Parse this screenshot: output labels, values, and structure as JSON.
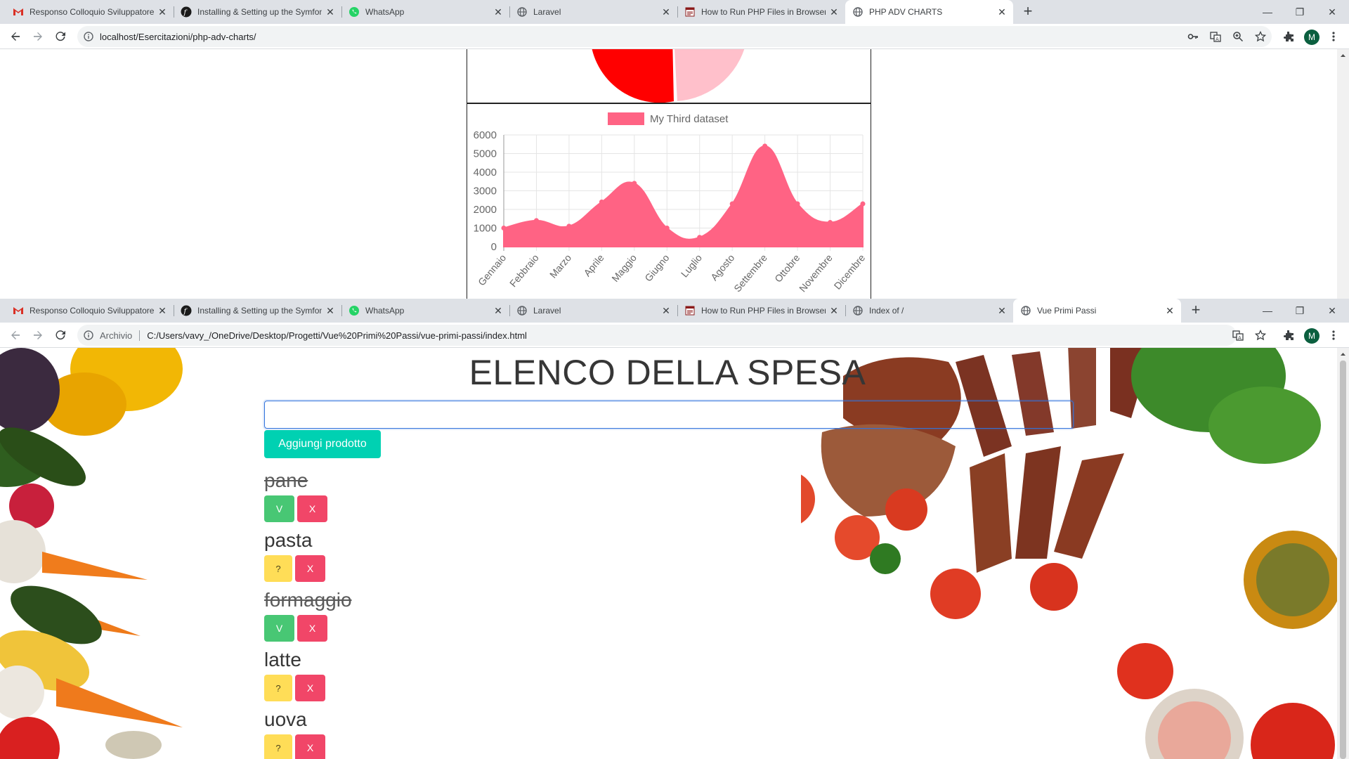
{
  "window1": {
    "tabs": [
      {
        "title": "Responso Colloquio Sviluppatore",
        "icon": "gmail-icon"
      },
      {
        "title": "Installing & Setting up the Symfony",
        "icon": "symfony-icon"
      },
      {
        "title": "WhatsApp",
        "icon": "whatsapp-icon"
      },
      {
        "title": "Laravel",
        "icon": "globe-icon"
      },
      {
        "title": "How to Run PHP Files in Browser",
        "icon": "php-icon"
      },
      {
        "title": "PHP ADV CHARTS",
        "icon": "globe-icon",
        "active": true
      }
    ],
    "url": "localhost/Esercitazioni/php-adv-charts/",
    "profile_initial": "M"
  },
  "window2": {
    "tabs": [
      {
        "title": "Responso Colloquio Sviluppatore",
        "icon": "gmail-icon"
      },
      {
        "title": "Installing & Setting up the Symfony",
        "icon": "symfony-icon"
      },
      {
        "title": "WhatsApp",
        "icon": "whatsapp-icon"
      },
      {
        "title": "Laravel",
        "icon": "globe-icon"
      },
      {
        "title": "How to Run PHP Files in Browser",
        "icon": "php-icon"
      },
      {
        "title": "Index of /",
        "icon": "globe-icon"
      },
      {
        "title": "Vue Primi Passi",
        "icon": "globe-icon",
        "active": true
      }
    ],
    "url_label": "Archivio",
    "url": "C:/Users/vavy_/OneDrive/Desktop/Progetti/Vue%20Primi%20Passi/vue-primi-passi/index.html",
    "profile_initial": "M",
    "page": {
      "title": "ELENCO DELLA SPESA",
      "input_value": "",
      "add_button": "Aggiungi prodotto",
      "items": [
        {
          "name": "pane",
          "done": true,
          "toggle": "V",
          "remove": "X"
        },
        {
          "name": "pasta",
          "done": false,
          "toggle": "?",
          "remove": "X"
        },
        {
          "name": "formaggio",
          "done": true,
          "toggle": "V",
          "remove": "X"
        },
        {
          "name": "latte",
          "done": false,
          "toggle": "?",
          "remove": "X"
        },
        {
          "name": "uova",
          "done": false,
          "toggle": "?",
          "remove": "X"
        }
      ]
    }
  },
  "colors": {
    "chart_fill": "#ff6384",
    "pie_red": "#ff0000",
    "pie_pink": "#ffc0cb",
    "primary": "#00d1b2",
    "success": "#48c774",
    "warning": "#ffdd57",
    "danger": "#f14668"
  },
  "chart_data": {
    "type": "area",
    "legend": "My Third dataset",
    "legend_position": "top",
    "categories": [
      "Gennaio",
      "Febbraio",
      "Marzo",
      "Aprile",
      "Maggio",
      "Giugno",
      "Luglio",
      "Agosto",
      "Settembre",
      "Ottobre",
      "Novembre",
      "Dicembre"
    ],
    "series": [
      {
        "name": "My Third dataset",
        "values": [
          1000,
          1400,
          1100,
          2400,
          3400,
          1000,
          500,
          2300,
          5400,
          2300,
          1300,
          2300
        ]
      }
    ],
    "yticks": [
      "0",
      "1000",
      "2000",
      "3000",
      "4000",
      "5000",
      "6000"
    ],
    "ylim": [
      0,
      6000
    ],
    "grid": true
  }
}
